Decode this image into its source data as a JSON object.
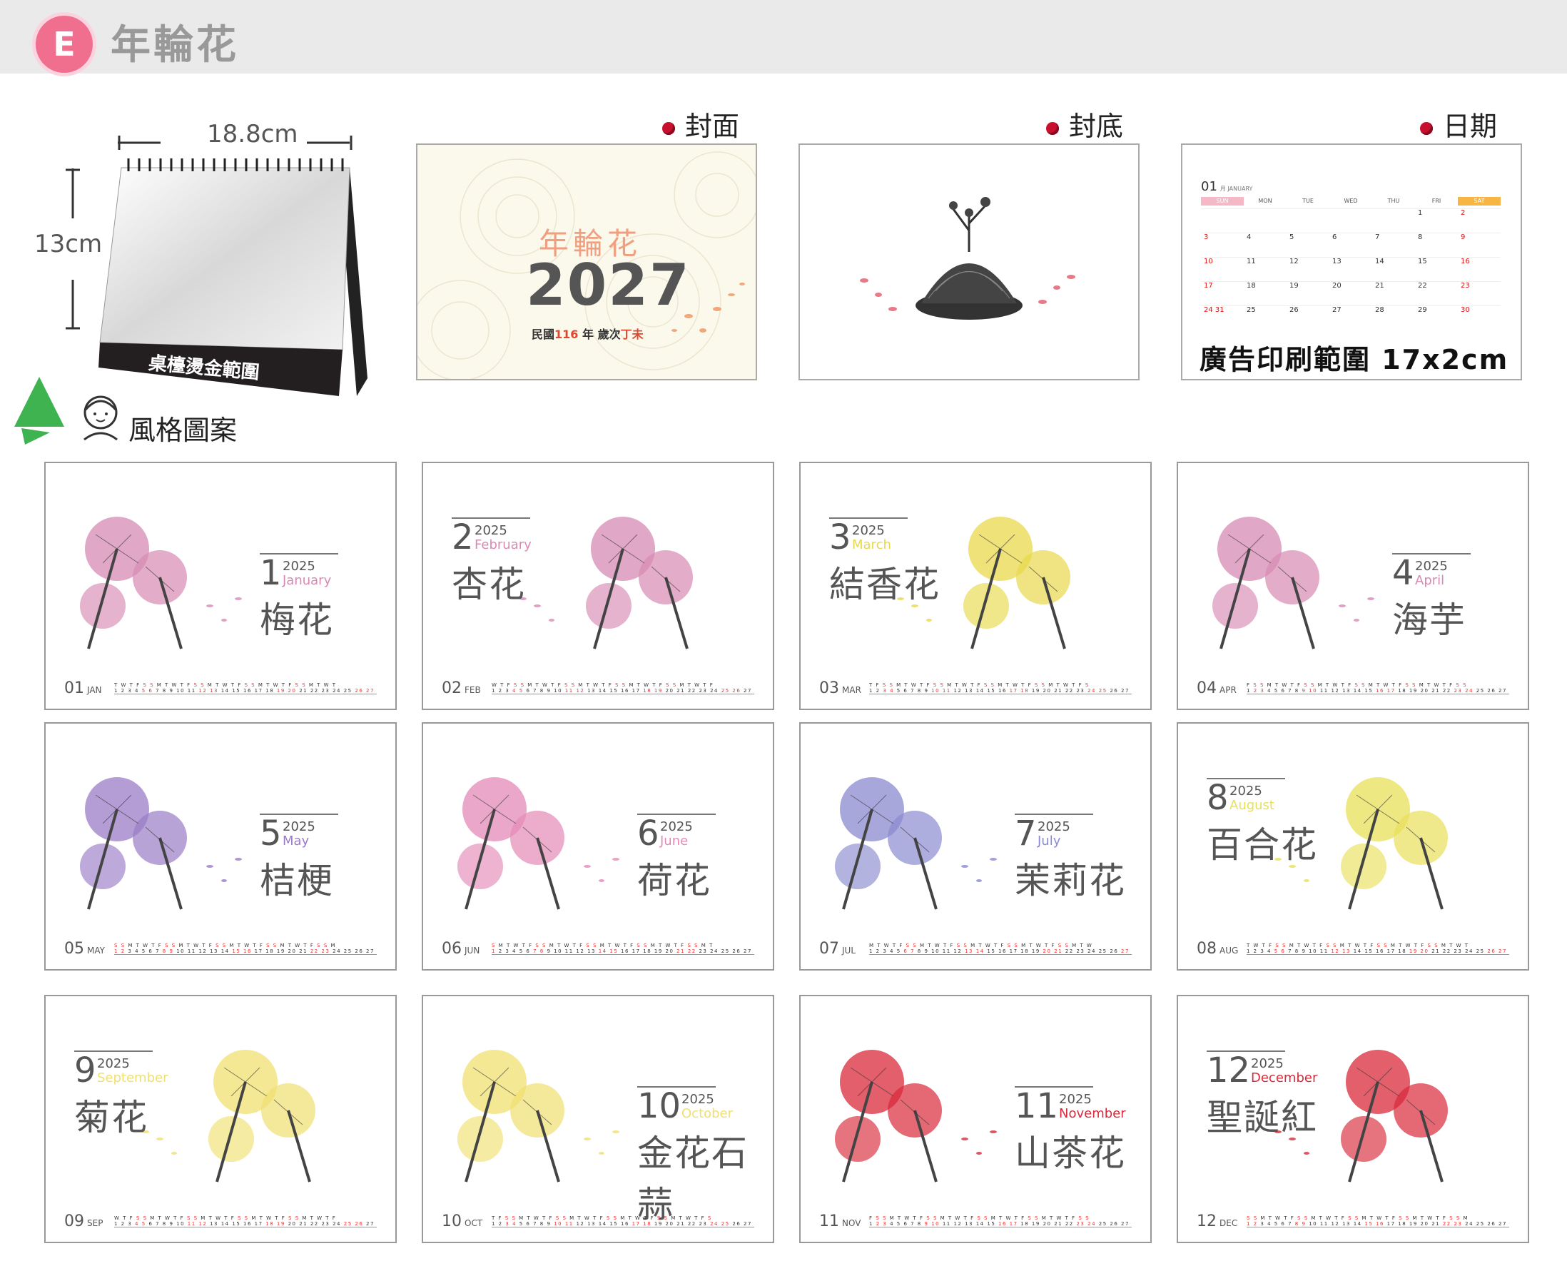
{
  "header": {
    "badge": "E",
    "title": "年輪花"
  },
  "product": {
    "width_label": "18.8cm",
    "height_label": "13cm",
    "base_text": "桌檯燙金範圍",
    "style_label": "風格圖案"
  },
  "views": {
    "cover": {
      "label": "封面",
      "title": "年輪花",
      "year": "2027",
      "sub_prefix": "民國",
      "sub_num": "116",
      "sub_mid": "年  歲次",
      "sub_gz": "丁未"
    },
    "back": {
      "label": "封底"
    },
    "date": {
      "label": "日期",
      "month_num": "01",
      "month_name": "月 JANUARY",
      "weekdays": [
        "SUN",
        "MON",
        "TUE",
        "WED",
        "THU",
        "FRI",
        "SAT"
      ],
      "ad_text": "廣告印刷範圍 17x2cm"
    }
  },
  "months": [
    {
      "num": "1",
      "year": "2025",
      "name": "January",
      "flower": "梅花",
      "code": "01",
      "abbr": "JAN",
      "color": "#d78ab4"
    },
    {
      "num": "2",
      "year": "2025",
      "name": "February",
      "flower": "杏花",
      "code": "02",
      "abbr": "FEB",
      "color": "#d78ab4"
    },
    {
      "num": "3",
      "year": "2025",
      "name": "March",
      "flower": "結香花",
      "code": "03",
      "abbr": "MAR",
      "color": "#e8d84c"
    },
    {
      "num": "4",
      "year": "2025",
      "name": "April",
      "flower": "海芋",
      "code": "04",
      "abbr": "APR",
      "color": "#d78ab4"
    },
    {
      "num": "5",
      "year": "2025",
      "name": "May",
      "flower": "桔梗",
      "code": "05",
      "abbr": "MAY",
      "color": "#9a7cc6"
    },
    {
      "num": "6",
      "year": "2025",
      "name": "June",
      "flower": "荷花",
      "code": "06",
      "abbr": "JUN",
      "color": "#e48ab8"
    },
    {
      "num": "7",
      "year": "2025",
      "name": "July",
      "flower": "茉莉花",
      "code": "07",
      "abbr": "JUL",
      "color": "#8a8ad0"
    },
    {
      "num": "8",
      "year": "2025",
      "name": "August",
      "flower": "百合花",
      "code": "08",
      "abbr": "AUG",
      "color": "#e8e05a"
    },
    {
      "num": "9",
      "year": "2025",
      "name": "September",
      "flower": "菊花",
      "code": "09",
      "abbr": "SEP",
      "color": "#f0e070"
    },
    {
      "num": "10",
      "year": "2025",
      "name": "October",
      "flower": "金花石蒜",
      "code": "10",
      "abbr": "OCT",
      "color": "#f0e070"
    },
    {
      "num": "11",
      "year": "2025",
      "name": "November",
      "flower": "山茶花",
      "code": "11",
      "abbr": "NOV",
      "color": "#d82a3a"
    },
    {
      "num": "12",
      "year": "2025",
      "name": "December",
      "flower": "聖誕紅",
      "code": "12",
      "abbr": "DEC",
      "color": "#d82a3a"
    }
  ]
}
